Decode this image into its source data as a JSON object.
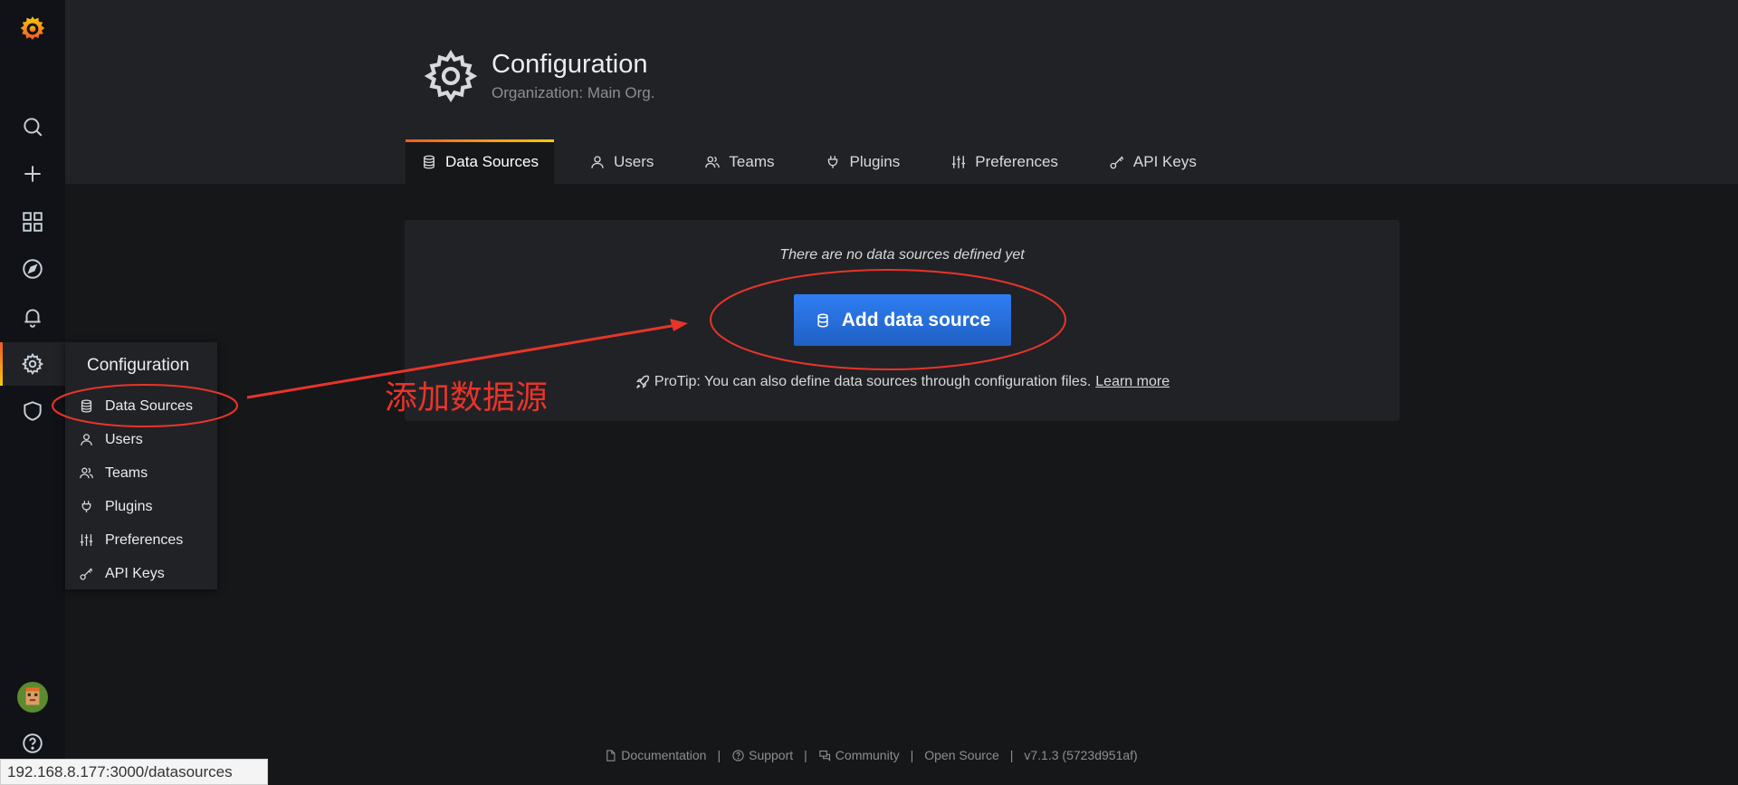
{
  "header": {
    "title": "Configuration",
    "subtitle": "Organization: Main Org."
  },
  "tabs": [
    {
      "label": "Data Sources",
      "icon": "database-icon",
      "active": true
    },
    {
      "label": "Users",
      "icon": "user-icon",
      "active": false
    },
    {
      "label": "Teams",
      "icon": "users-icon",
      "active": false
    },
    {
      "label": "Plugins",
      "icon": "plug-icon",
      "active": false
    },
    {
      "label": "Preferences",
      "icon": "sliders-icon",
      "active": false
    },
    {
      "label": "API Keys",
      "icon": "key-icon",
      "active": false
    }
  ],
  "empty_state": {
    "message": "There are no data sources defined yet",
    "button_label": "Add data source",
    "protip_text": "ProTip: You can also define data sources through configuration files.",
    "protip_link": "Learn more"
  },
  "flyout": {
    "title": "Configuration",
    "items": [
      {
        "label": "Data Sources",
        "icon": "database-icon"
      },
      {
        "label": "Users",
        "icon": "user-icon"
      },
      {
        "label": "Teams",
        "icon": "users-icon"
      },
      {
        "label": "Plugins",
        "icon": "plug-icon"
      },
      {
        "label": "Preferences",
        "icon": "sliders-icon"
      },
      {
        "label": "API Keys",
        "icon": "key-icon"
      }
    ]
  },
  "annotation": {
    "text": "添加数据源",
    "color": "#e8342a"
  },
  "footer": {
    "documentation": "Documentation",
    "support": "Support",
    "community": "Community",
    "open_source": "Open Source",
    "version": "v7.1.3 (5723d951af)",
    "separator": "|"
  },
  "status_url": "192.168.8.177:3000/datasources",
  "colors": {
    "accent_orange": "#f05a28",
    "accent_yellow": "#fbca0a",
    "primary_blue": "#1f60c4",
    "background": "#161719",
    "panel": "#202226"
  }
}
